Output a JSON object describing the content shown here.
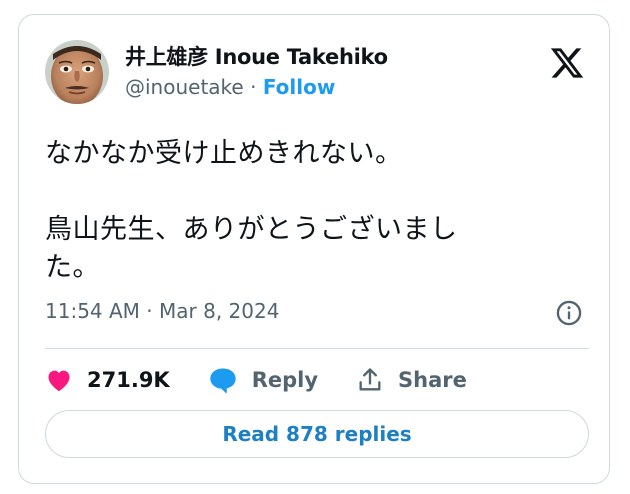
{
  "author": {
    "display_name": "井上雄彦 Inoue Takehiko",
    "handle": "@inouetake",
    "separator": " · ",
    "follow_label": "Follow"
  },
  "tweet": {
    "text": "なかなか受け止めきれない。\n\n鳥山先生、ありがとうございまし\nた。",
    "timestamp": "11:54 AM · Mar 8, 2024"
  },
  "actions": {
    "likes": "271.9K",
    "reply_label": "Reply",
    "share_label": "Share"
  },
  "read_replies_label": "Read 878 replies",
  "colors": {
    "like": "#f91880",
    "reply": "#1d9bf0",
    "link": "#1d9bf0",
    "muted": "#536471",
    "border": "#cfd9de"
  },
  "icons": [
    "x-logo-icon",
    "heart-icon",
    "reply-bubble-icon",
    "share-icon",
    "info-icon"
  ]
}
